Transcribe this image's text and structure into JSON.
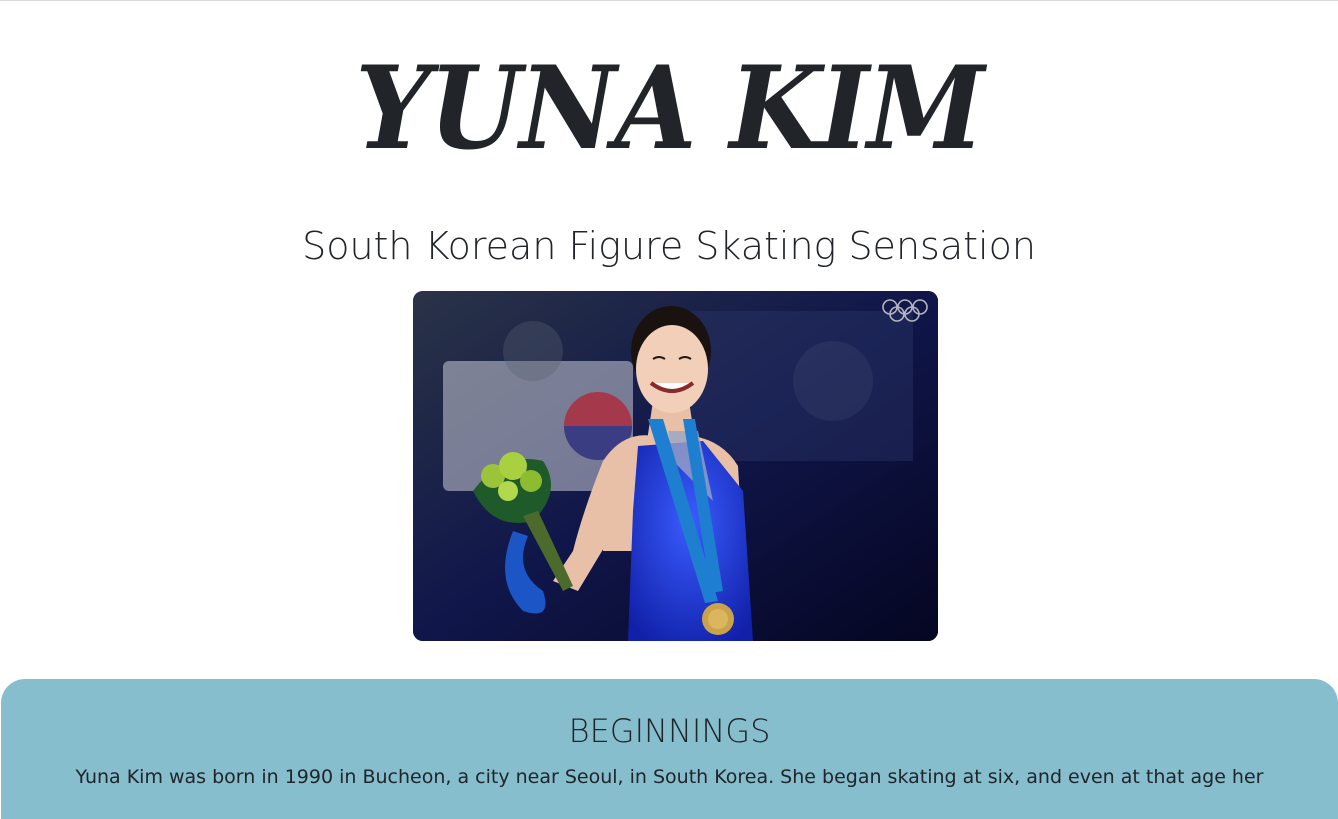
{
  "header": {
    "title": "YUNA KIM",
    "subtitle": "South Korean Figure Skating Sensation"
  },
  "image": {
    "alt": "Yuna Kim smiling with a gold medal and bouquet at Vancouver 2010"
  },
  "section": {
    "heading": "BEGINNINGS",
    "text": "Yuna Kim was born in 1990 in Bucheon, a city near Seoul, in South Korea. She began skating at six, and even at that age her"
  },
  "colors": {
    "section_bg": "#86bece",
    "text": "#212529"
  }
}
